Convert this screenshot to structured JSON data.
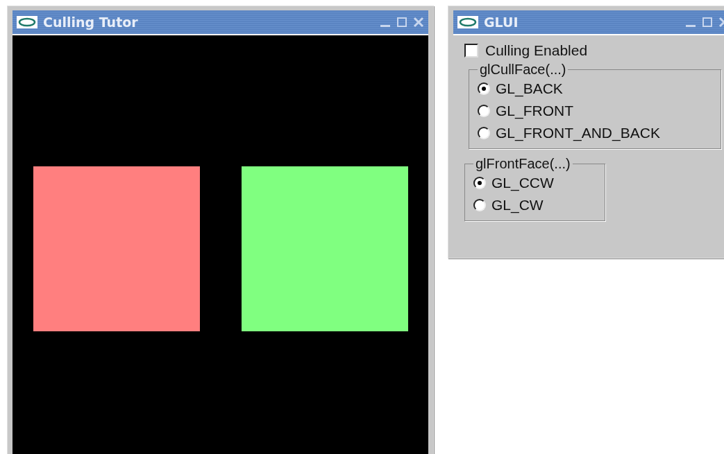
{
  "main_window": {
    "title": "Culling Tutor",
    "squares": [
      {
        "color": "#ff7f7f"
      },
      {
        "color": "#80ff80"
      }
    ]
  },
  "control_window": {
    "title": "GLUI",
    "checkbox": {
      "label": "Culling Enabled",
      "checked": false
    },
    "groups": [
      {
        "title": "glCullFace(...)",
        "options": [
          {
            "label": "GL_BACK",
            "selected": true
          },
          {
            "label": "GL_FRONT",
            "selected": false
          },
          {
            "label": "GL_FRONT_AND_BACK",
            "selected": false
          }
        ]
      },
      {
        "title": "glFrontFace(...)",
        "options": [
          {
            "label": "GL_CCW",
            "selected": true
          },
          {
            "label": "GL_CW",
            "selected": false
          }
        ]
      }
    ]
  }
}
